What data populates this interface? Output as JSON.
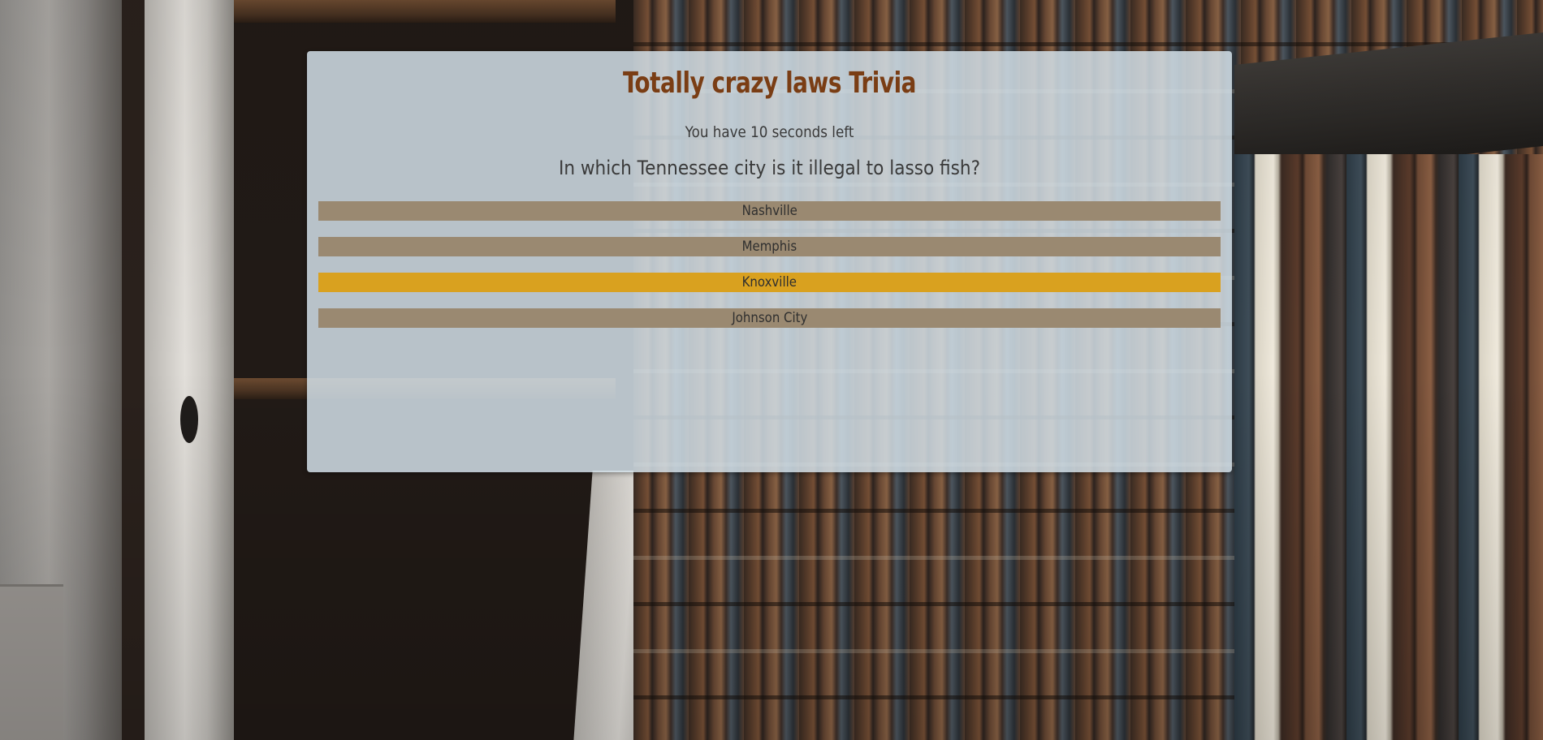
{
  "quiz": {
    "title": "Totally crazy laws Trivia",
    "timer_text": "You have 10 seconds left",
    "question": "In which Tennessee city is it illegal to lasso fish?",
    "answers": [
      {
        "label": "Nashville",
        "selected": false
      },
      {
        "label": "Memphis",
        "selected": false
      },
      {
        "label": "Knoxville",
        "selected": true
      },
      {
        "label": "Johnson City",
        "selected": false
      }
    ]
  },
  "colors": {
    "title": "#7a3d14",
    "answer_default": "#9a8971",
    "answer_selected": "#d9a11f",
    "card_background": "#d2dee6"
  }
}
